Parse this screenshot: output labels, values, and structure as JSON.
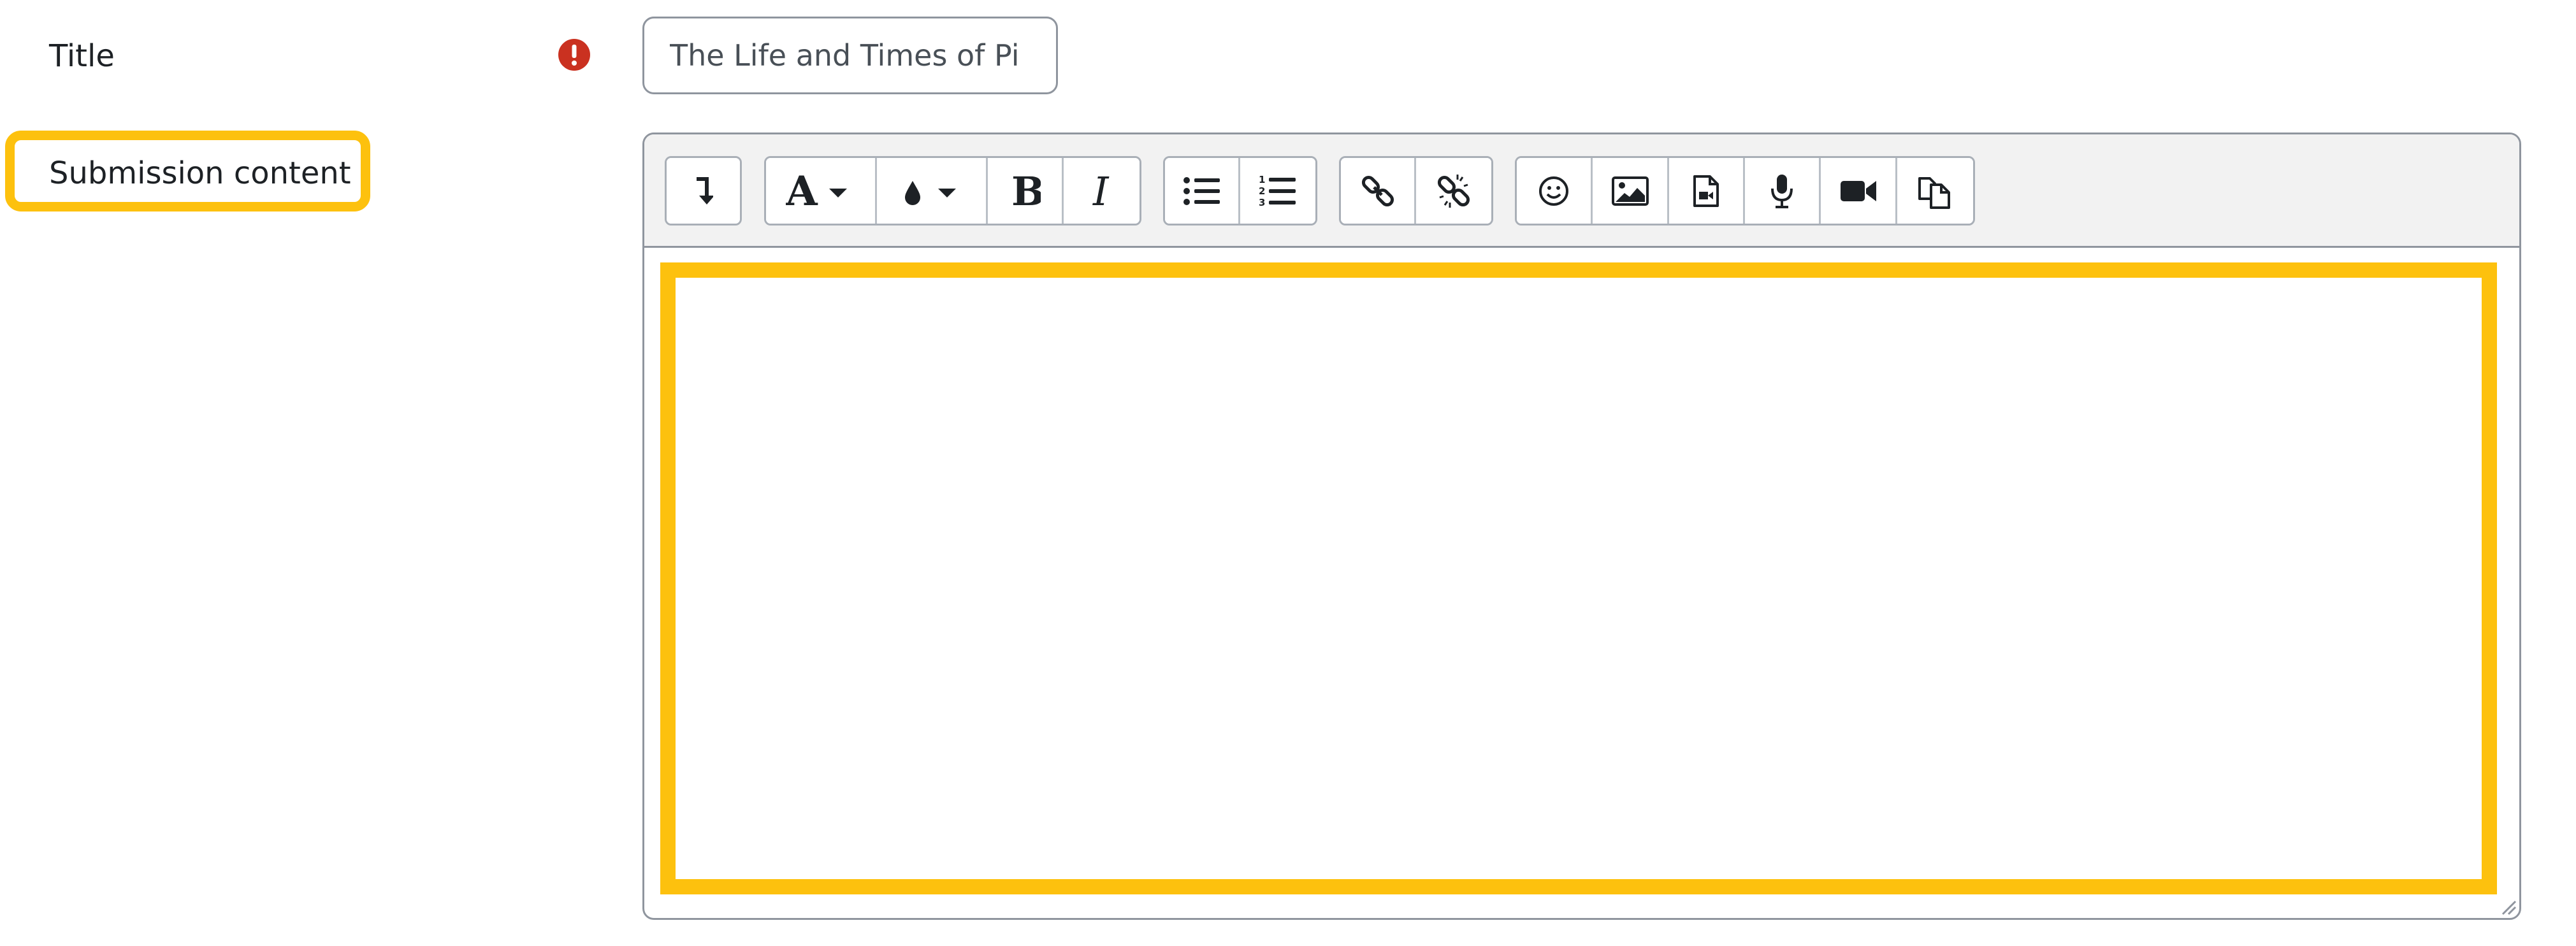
{
  "form": {
    "title_label": "Title",
    "title_value": "The Life and Times of Pi",
    "submission_label": "Submission content"
  },
  "editor": {
    "content": "",
    "toolbar_groups": [
      [
        "show-more-icon"
      ],
      [
        "font-style-icon",
        "text-color-icon",
        "bold-icon",
        "italic-icon"
      ],
      [
        "bullet-list-icon",
        "numbered-list-icon"
      ],
      [
        "link-icon",
        "unlink-icon"
      ],
      [
        "emoji-icon",
        "image-icon",
        "media-icon",
        "record-audio-icon",
        "record-video-icon",
        "manage-files-icon"
      ]
    ]
  },
  "colors": {
    "highlight": "#fdc10e",
    "required": "#ca3120",
    "border": "#8f959e",
    "toolbar_bg": "#f2f2f2"
  }
}
